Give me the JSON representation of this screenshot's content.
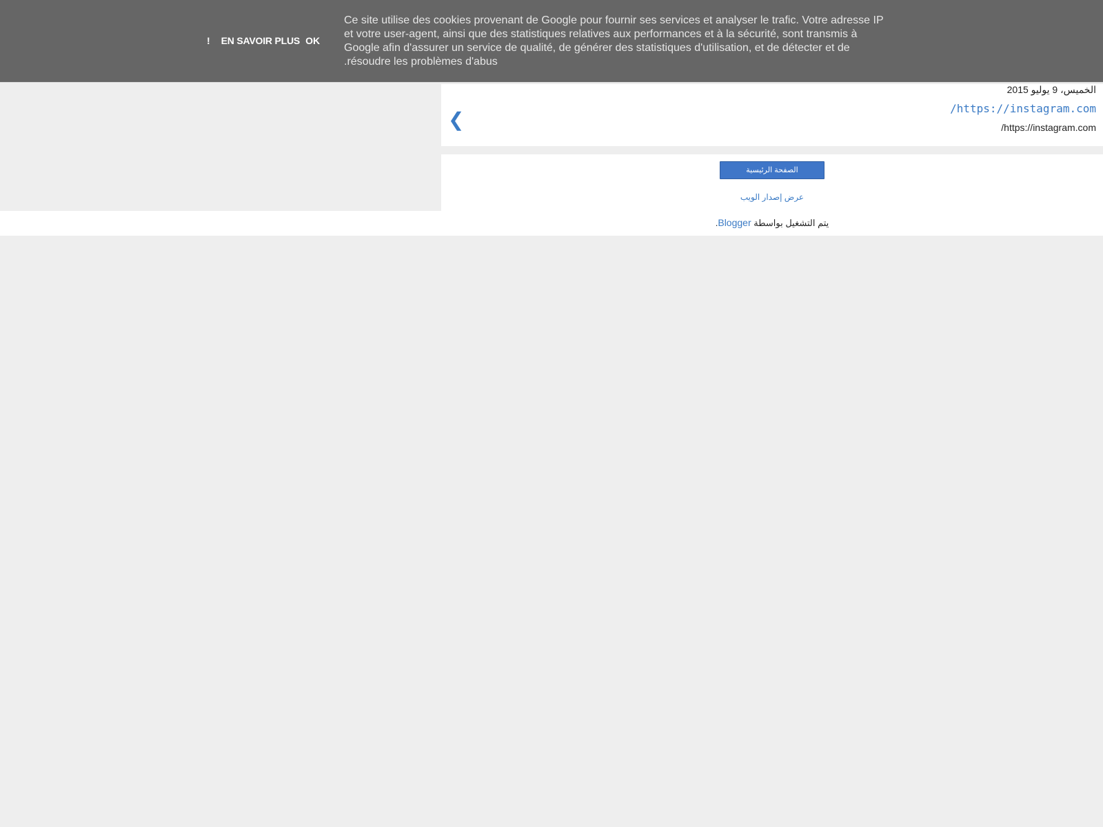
{
  "cookie_bar": {
    "message": "Ce site utilise des cookies provenant de Google pour fournir ses services et analyser le trafic. Votre adresse IP et votre user-agent, ainsi que des statistiques relatives aux performances et à la sécurité, sont transmis à Google afin d'assurer un service de qualité, de générer des statistiques d'utilisation, et de détecter et de résoudre les problèmes d'abus.",
    "learn_more_label": "EN SAVOIR PLUS",
    "ok_label": "OK",
    "bang_label": "!"
  },
  "post": {
    "date": "الخميس، 9 يوليو 2015",
    "title": "https://instagram.com/",
    "body": "https://instagram.com/",
    "nav_glyph": "❮"
  },
  "mobile_nav": {
    "home_label": "الصفحة الرئيسية",
    "web_version_label": "عرض إصدار الويب"
  },
  "footer": {
    "powered_prefix": "يتم التشغيل بواسطة ",
    "brand": "Blogger",
    "suffix": "."
  },
  "colors": {
    "cookie_bg": "#666666",
    "link_blue": "#3b7bc5",
    "button_blue": "#3f76c8",
    "page_bg": "#eeeeee"
  }
}
